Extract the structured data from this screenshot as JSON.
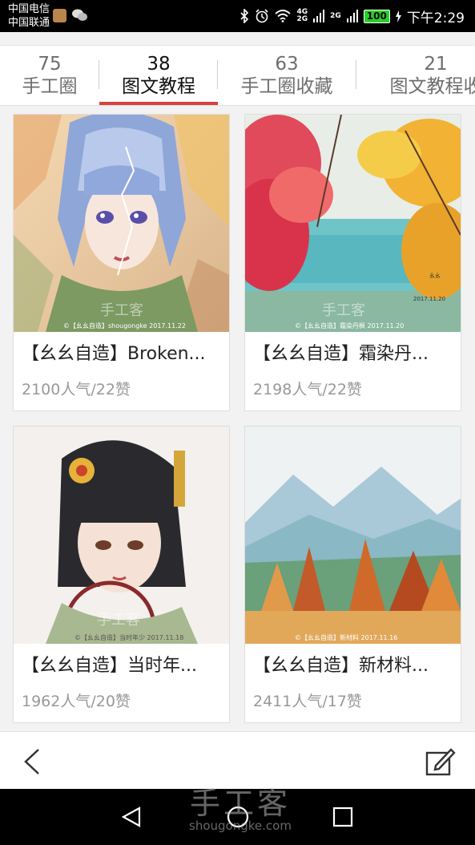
{
  "status_bar": {
    "carrier_1": "中国电信",
    "carrier_2": "中国联通",
    "network_1": "4G",
    "network_2": "2G",
    "network_3": "2G",
    "battery": "100",
    "time": "下午2:29"
  },
  "tabs": [
    {
      "count": "75",
      "label": "手工圈"
    },
    {
      "count": "38",
      "label": "图文教程"
    },
    {
      "count": "63",
      "label": "手工圈收藏"
    },
    {
      "count": "21",
      "label": "图文教程收"
    }
  ],
  "cards": [
    {
      "title": "【幺幺自造】Broken...",
      "stats": "2100人气/22赞",
      "caption": "©【幺幺自造】shougongke 2017.11.22",
      "wm": "手工客"
    },
    {
      "title": "【幺幺自造】霜染丹...",
      "stats": "2198人气/22赞",
      "caption": "©【幺幺自造】霜染丹枫 2017.11.20",
      "wm": "手工客"
    },
    {
      "title": "【幺幺自造】当时年...",
      "stats": "1962人气/20赞",
      "caption": "©【幺幺自造】当时年少 2017.11.18",
      "wm": "手工客"
    },
    {
      "title": "【幺幺自造】新材料...",
      "stats": "2411人气/17赞",
      "caption": "©【幺幺自造】新材料 2017.11.16",
      "wm": ""
    }
  ],
  "watermark": {
    "main": "手工客",
    "sub": "shougongke.com"
  },
  "colors": {
    "accent": "#d9413a",
    "battery": "#2ad02a"
  }
}
